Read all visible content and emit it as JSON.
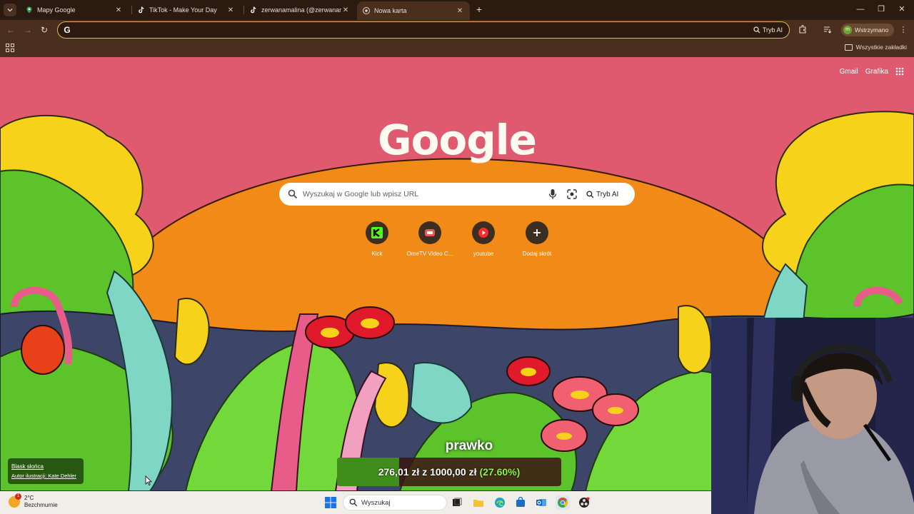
{
  "browser": {
    "tabs": [
      {
        "label": "Mapy Google",
        "icon": "maps-pin-icon",
        "active": false
      },
      {
        "label": "TikTok - Make Your Day",
        "icon": "tiktok-icon",
        "active": false
      },
      {
        "label": "zerwanamalina (@zerwanamali",
        "icon": "tiktok-icon",
        "active": false
      },
      {
        "label": "Nowa karta",
        "icon": "chrome-icon",
        "active": true
      }
    ],
    "omnibox": {
      "value": "",
      "ai_label": "Tryb AI"
    },
    "profile_label": "Wstrzymano",
    "profile_initial": "m",
    "bookmarks_label": "Wszystkie zakładki"
  },
  "ntp": {
    "toplinks": {
      "gmail": "Gmail",
      "images": "Grafika"
    },
    "logo": "Google",
    "search_placeholder": "Wyszukaj w Google lub wpisz URL",
    "ai_label": "Tryb AI",
    "shortcuts": [
      {
        "name": "Kick",
        "icon": "kick-icon"
      },
      {
        "name": "OmeTV Video C...",
        "icon": "ometv-icon"
      },
      {
        "name": "youtube",
        "icon": "youtube-icon"
      },
      {
        "name": "Dodaj skrót",
        "icon": "plus-icon"
      }
    ],
    "credit": {
      "title": "Blask słońca",
      "author": "Autor ilustracji: Kate Dehler"
    }
  },
  "stream_overlay": {
    "title": "prawko",
    "current": "276,01 zł",
    "joiner": "z",
    "goal": "1000,00 zł",
    "percent_text": "(27.60%)",
    "progress_fraction": 0.276
  },
  "taskbar": {
    "weather_temp": "2°C",
    "weather_desc": "Bezchmurnie",
    "weather_badge": "1",
    "search_label": "Wyszukaj",
    "apps": [
      "task-view-icon",
      "file-explorer-icon",
      "edge-icon",
      "store-icon",
      "outlook-icon",
      "chrome-icon",
      "obs-icon"
    ]
  },
  "colors": {
    "chrome_bg": "#4a2f1f",
    "accent": "#e2b56a",
    "sky_pink": "#df5a6e",
    "sun_orange": "#f18a16",
    "grass_green": "#5cc42a"
  }
}
